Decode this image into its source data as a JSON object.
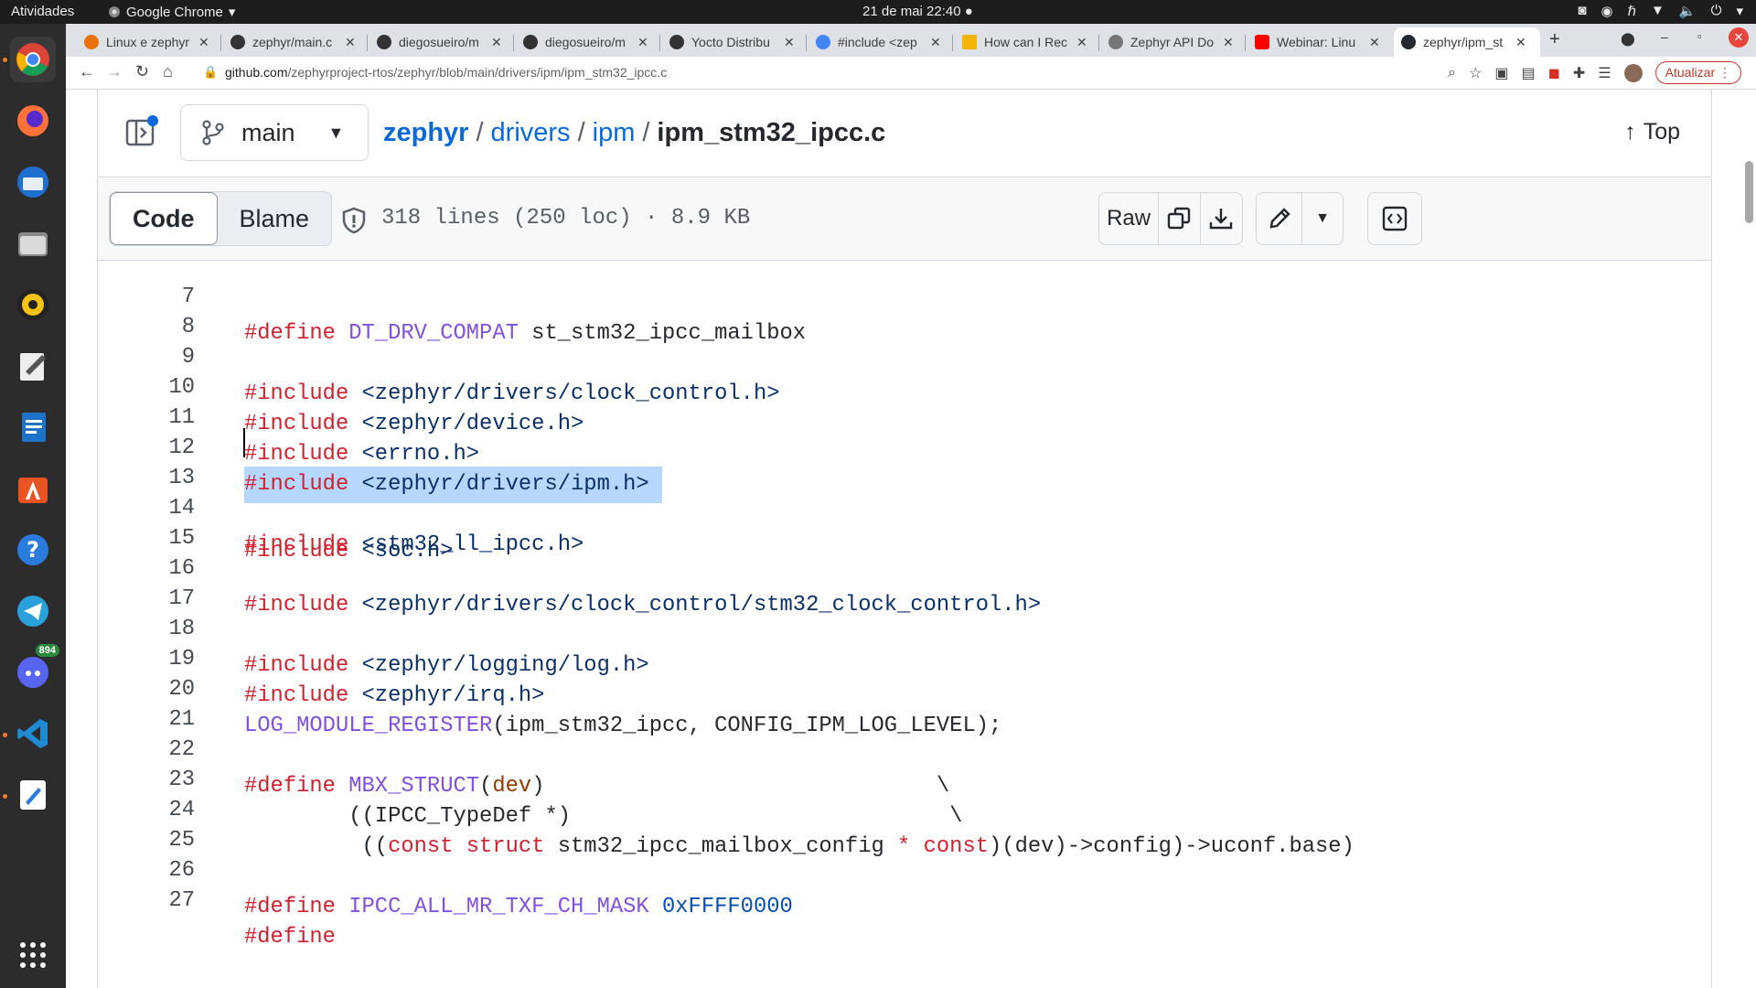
{
  "system_bar": {
    "activities": "Atividades",
    "app_name": "Google Chrome",
    "clock": "21 de mai  22:40"
  },
  "dock": {
    "discord_badge": "894"
  },
  "browser": {
    "tabs": [
      {
        "title": "Linux e zephyr",
        "active": false
      },
      {
        "title": "zephyr/main.c",
        "active": false
      },
      {
        "title": "diegosueiro/m",
        "active": false
      },
      {
        "title": "diegosueiro/m",
        "active": false
      },
      {
        "title": "Yocto Distribu",
        "active": false
      },
      {
        "title": "#include <zep",
        "active": false
      },
      {
        "title": "How can I Rec",
        "active": false
      },
      {
        "title": "Zephyr API Do",
        "active": false
      },
      {
        "title": "Webinar: Linu",
        "active": false
      },
      {
        "title": "zephyr/ipm_st",
        "active": true
      }
    ],
    "new_tab": "+",
    "url_host": "github.com",
    "url_path": "/zephyrproject-rtos/zephyr/blob/main/drivers/ipm/ipm_stm32_ipcc.c",
    "update_label": "Atualizar"
  },
  "github": {
    "branch": "main",
    "breadcrumb": {
      "repo": "zephyr",
      "sep": "/",
      "dir1": "drivers",
      "dir2": "ipm",
      "file": "ipm_stm32_ipcc.c"
    },
    "top_label": "Top",
    "tab_code": "Code",
    "tab_blame": "Blame",
    "file_meta": "318 lines (250 loc) · 8.9 KB",
    "raw_label": "Raw"
  },
  "code_lines": [
    {
      "n": "7",
      "text": "#define DT_DRV_COMPAT st_stm32_ipcc_mailbox"
    },
    {
      "n": "8",
      "text": ""
    },
    {
      "n": "9",
      "text": "#include <zephyr/drivers/clock_control.h>"
    },
    {
      "n": "10",
      "text": "#include <zephyr/device.h>"
    },
    {
      "n": "11",
      "text": "#include <errno.h>"
    },
    {
      "n": "12",
      "text": "#include <zephyr/drivers/ipm.h>"
    },
    {
      "n": "13",
      "text": "#include <soc.h>"
    },
    {
      "n": "14",
      "text": "#include <stm32_ll_ipcc.h>"
    },
    {
      "n": "15",
      "text": ""
    },
    {
      "n": "16",
      "text": "#include <zephyr/drivers/clock_control/stm32_clock_control.h>"
    },
    {
      "n": "17",
      "text": ""
    },
    {
      "n": "18",
      "text": "#include <zephyr/logging/log.h>"
    },
    {
      "n": "19",
      "text": "#include <zephyr/irq.h>"
    },
    {
      "n": "20",
      "text": "LOG_MODULE_REGISTER(ipm_stm32_ipcc, CONFIG_IPM_LOG_LEVEL);"
    },
    {
      "n": "21",
      "text": ""
    },
    {
      "n": "22",
      "text": "#define MBX_STRUCT(dev)                               \\"
    },
    {
      "n": "23",
      "text": "        ((IPCC_TypeDef *)                             \\"
    },
    {
      "n": "24",
      "text": "         ((const struct stm32_ipcc_mailbox_config * const)(dev)->config)->uconf.base)"
    },
    {
      "n": "25",
      "text": ""
    },
    {
      "n": "26",
      "text": "#define IPCC_ALL_MR_TXF_CH_MASK 0xFFFF0000"
    },
    {
      "n": "27",
      "text": "#define"
    }
  ],
  "highlighted_line": "12",
  "caret_line": "13"
}
